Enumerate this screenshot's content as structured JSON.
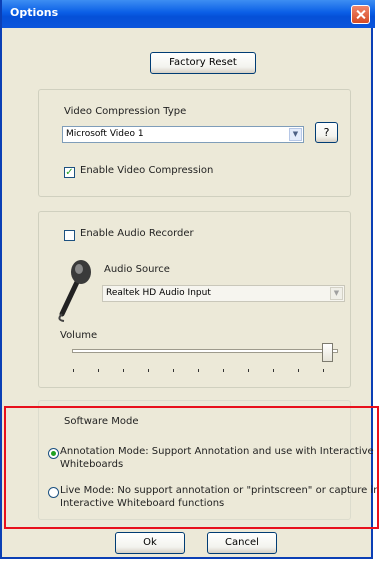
{
  "window": {
    "title": "Options"
  },
  "factory_reset_label": "Factory Reset",
  "video": {
    "label": "Video Compression Type",
    "codec_value": "Microsoft Video 1",
    "help_label": "?",
    "enable_label": "Enable Video Compression",
    "enable_checked": true
  },
  "audio": {
    "enable_label": "Enable Audio Recorder",
    "enable_checked": false,
    "source_label": "Audio Source",
    "source_value": "Realtek HD Audio Input",
    "volume_label": "Volume",
    "volume_level": 0.95
  },
  "software_mode": {
    "label": "Software Mode",
    "annotation_label": "Annotation Mode: Support Annotation and use with Interactive Whiteboards",
    "annotation_selected": true,
    "live_label": "Live Mode: No support annotation or \"printscreen\" or capture in Interactive Whiteboard functions",
    "live_selected": false
  },
  "footer": {
    "ok_label": "Ok",
    "cancel_label": "Cancel"
  },
  "colors": {
    "titlebar": "#0a5ee6",
    "highlight_box": "#e8101c",
    "dialog_bg": "#ece9d8"
  }
}
